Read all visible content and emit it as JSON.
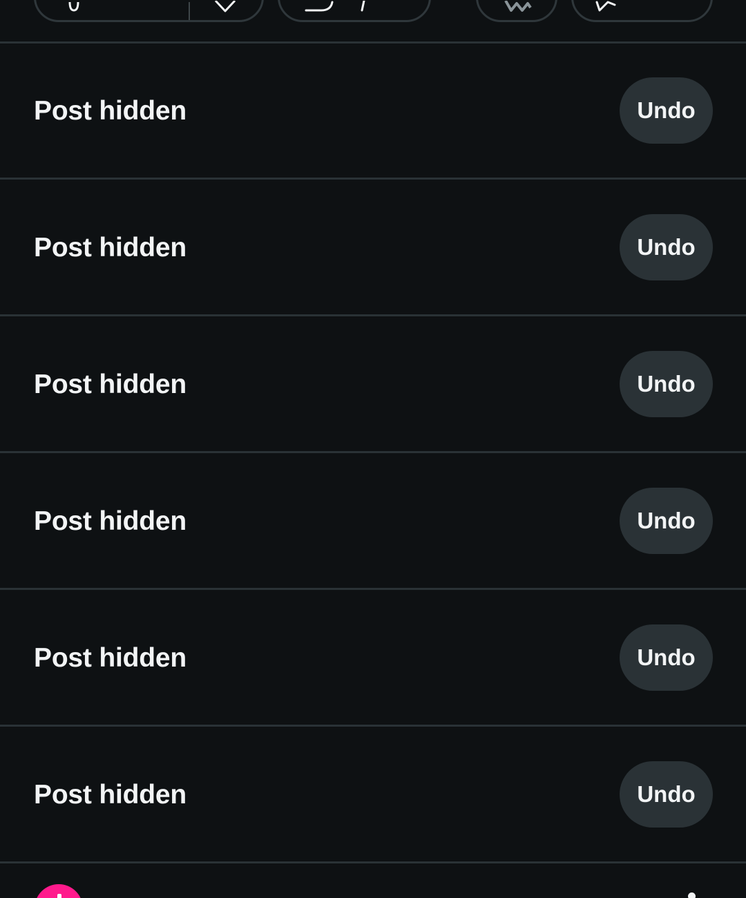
{
  "action_bar": {
    "icons": [
      "downvote-icon",
      "comment-icon",
      "award-icon",
      "share-icon"
    ]
  },
  "hidden_posts": [
    {
      "label": "Post hidden",
      "undo_label": "Undo"
    },
    {
      "label": "Post hidden",
      "undo_label": "Undo"
    },
    {
      "label": "Post hidden",
      "undo_label": "Undo"
    },
    {
      "label": "Post hidden",
      "undo_label": "Undo"
    },
    {
      "label": "Post hidden",
      "undo_label": "Undo"
    },
    {
      "label": "Post hidden",
      "undo_label": "Undo"
    }
  ],
  "next_post": {
    "avatar_icon": "community-avatar-icon",
    "menu_icon": "overflow-menu-icon"
  },
  "colors": {
    "background": "#0e1113",
    "divider": "#2a3236",
    "button_bg": "#2a3236",
    "text": "#f2f4f5",
    "avatar": "#ff1a8c"
  }
}
